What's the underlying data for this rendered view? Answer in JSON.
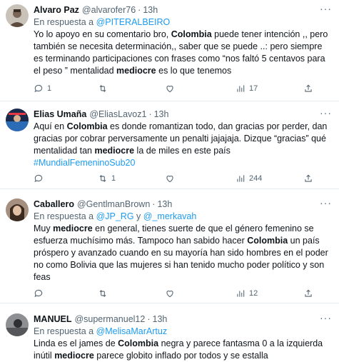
{
  "tweets": [
    {
      "name": "Alvaro Paz",
      "handle": "@alvarofer76",
      "time": "13h",
      "reply_prefix": "En respuesta a",
      "reply_to": [
        "@PITERALBEIRO"
      ],
      "body": [
        {
          "t": "Yo lo apoyo en su comentario bro, "
        },
        {
          "t": "Colombia",
          "b": true
        },
        {
          "t": " puede tener intención ,, pero también se necesita determinación,, saber que se puede ..: pero siempre es terminando participaciones con frases como “nos faltó 5 centavos para el peso ” mentalidad "
        },
        {
          "t": "mediocre",
          "b": true
        },
        {
          "t": " es lo que tenemos"
        }
      ],
      "replies": "1",
      "retweets": "",
      "likes": "",
      "views": "17"
    },
    {
      "name": "Elias Umaña",
      "handle": "@EliasLavoz1",
      "time": "13h",
      "reply_prefix": "",
      "reply_to": [],
      "body": [
        {
          "t": "Aquí en "
        },
        {
          "t": "Colombia",
          "b": true
        },
        {
          "t": " es donde romantizan todo, dan gracias por perder, dan gracias por cobrar perversamente un penalti jajajaja. Dizque “gracias” qué mentalidad tan "
        },
        {
          "t": "mediocre",
          "b": true
        },
        {
          "t": " la de miles en este país "
        },
        {
          "t": "#MundialFemeninoSub20",
          "link": true
        }
      ],
      "replies": "",
      "retweets": "1",
      "likes": "",
      "views": "244"
    },
    {
      "name": "Caballero",
      "handle": "@GentlmanBrown",
      "time": "13h",
      "reply_prefix": "En respuesta a",
      "reply_to": [
        "@JP_RG",
        "@_merkavah"
      ],
      "reply_joiner": "y",
      "body": [
        {
          "t": "Muy "
        },
        {
          "t": "mediocre",
          "b": true
        },
        {
          "t": " en general, tienes suerte de que el género femenino se esfuerza muchísimo más. Tampoco han sabido hacer "
        },
        {
          "t": "Colombia",
          "b": true
        },
        {
          "t": " un país próspero y avanzado cuando en su mayoría han sido hombres en el poder no como Bolivia que las mujeres si han tenido mucho poder político y son feas"
        }
      ],
      "replies": "",
      "retweets": "",
      "likes": "",
      "views": "12"
    },
    {
      "name": "MANUEL",
      "handle": "@supermanuel12",
      "time": "13h",
      "reply_prefix": "En respuesta a",
      "reply_to": [
        "@MelisaMarArtuz"
      ],
      "body": [
        {
          "t": "Linda es el james de "
        },
        {
          "t": "Colombia",
          "b": true
        },
        {
          "t": " negra y parece fantasma 0 a la izquierda inútil "
        },
        {
          "t": "mediocre",
          "b": true
        },
        {
          "t": " parece globito inflado por todos y se estalla"
        }
      ]
    }
  ],
  "icons": {
    "reply": "speech-bubble-icon",
    "retweet": "retweet-arrows-icon",
    "like": "heart-icon",
    "views": "bar-chart-icon",
    "share": "share-upload-icon",
    "more": "ellipsis-icon"
  },
  "colors": {
    "link": "#1d9bf0",
    "secondary_text": "#536471",
    "primary_text": "#0f1419",
    "divider": "#e6ecf0"
  }
}
